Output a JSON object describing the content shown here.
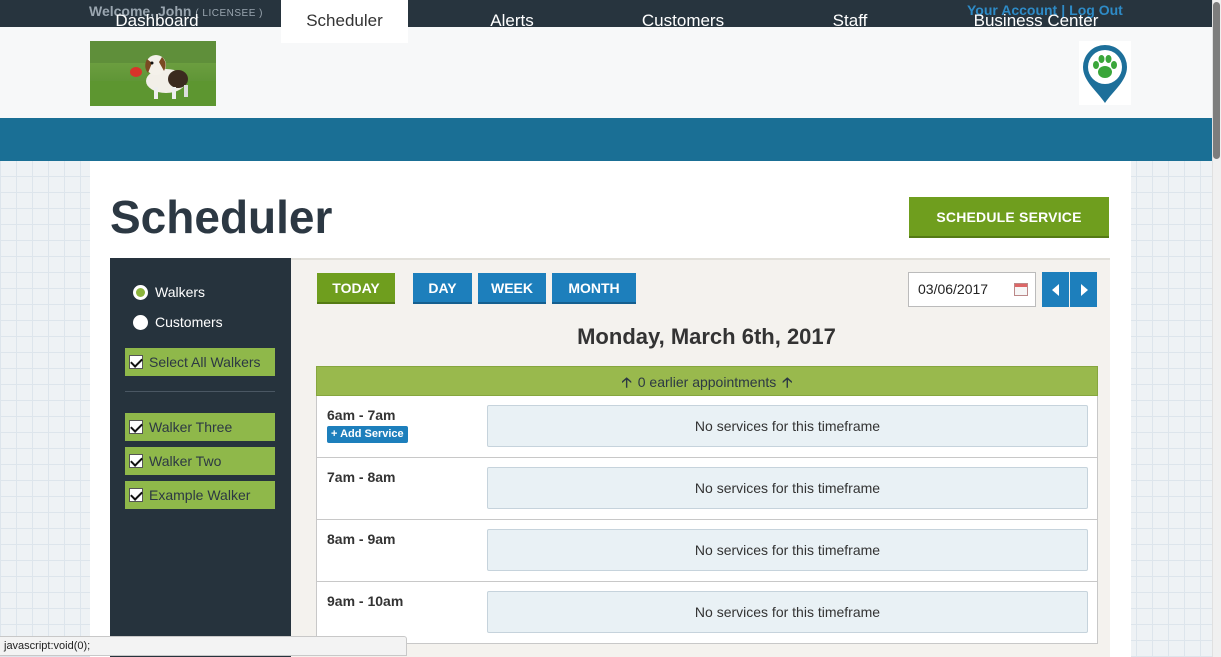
{
  "topbar": {
    "welcome": "Welcome, John",
    "role": "( LICENSEE )",
    "your_account": "Your Account",
    "separator": "|",
    "log_out": "Log Out"
  },
  "nav": {
    "items": [
      {
        "label": "Dashboard",
        "active": false
      },
      {
        "label": "Scheduler",
        "active": true
      },
      {
        "label": "Alerts",
        "active": false
      },
      {
        "label": "Customers",
        "active": false
      },
      {
        "label": "Staff",
        "active": false
      },
      {
        "label": "Business Center",
        "active": false
      }
    ]
  },
  "page": {
    "title": "Scheduler",
    "schedule_button": "SCHEDULE SERVICE"
  },
  "sidebar": {
    "radios": [
      {
        "label": "Walkers",
        "checked": true
      },
      {
        "label": "Customers",
        "checked": false
      }
    ],
    "select_all": "Select All Walkers",
    "walkers": [
      "Walker Three",
      "Walker Two",
      "Example Walker"
    ]
  },
  "toolbar": {
    "today": "TODAY",
    "day": "DAY",
    "week": "WEEK",
    "month": "MONTH",
    "date_value": "03/06/2017",
    "prev_icon": "chevron-left-icon",
    "next_icon": "chevron-right-icon"
  },
  "schedule": {
    "day_title": "Monday, March 6th, 2017",
    "earlier": "0 earlier appointments",
    "add_service": "+ Add Service",
    "slots": [
      {
        "time": "6am - 7am",
        "message": "No services for this timeframe"
      },
      {
        "time": "7am - 8am",
        "message": "No services for this timeframe"
      },
      {
        "time": "8am - 9am",
        "message": "No services for this timeframe"
      },
      {
        "time": "9am - 10am",
        "message": "No services for this timeframe"
      }
    ]
  },
  "statusbar": {
    "text": "javascript:void(0);"
  },
  "colors": {
    "nav": "#1a6f95",
    "topbar": "#27343e",
    "green": "#6f9e1e",
    "blue": "#1d7fbc",
    "sidebar": "#26333d"
  }
}
